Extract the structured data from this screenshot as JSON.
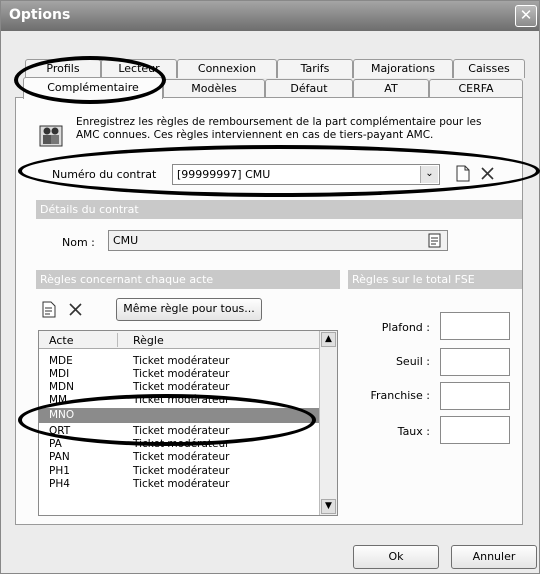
{
  "window": {
    "title": "Options",
    "close_glyph": "✕"
  },
  "tabs_back": [
    "Profils",
    "Lecteur",
    "Connexion",
    "Tarifs",
    "Majorations",
    "Caisses"
  ],
  "tabs_front": [
    "Complémentaire",
    "Modèles",
    "Défaut",
    "AT",
    "CERFA"
  ],
  "info": {
    "text_line1": "Enregistrez les règles de remboursement de la part complémentaire pour les",
    "text_line2": "AMC connues. Ces règles interviennent en cas de tiers-payant AMC."
  },
  "contract": {
    "label": "Numéro du contrat",
    "value": "[99999997] CMU"
  },
  "details": {
    "section": "Détails du contrat",
    "nom_label": "Nom :",
    "nom_value": "CMU"
  },
  "rules": {
    "section": "Règles concernant chaque acte",
    "same_rule_button": "Même règle pour tous...",
    "columns": [
      "Acte",
      "Règle"
    ],
    "rows": [
      {
        "acte": "MDE",
        "regle": "Ticket modérateur"
      },
      {
        "acte": "MDI",
        "regle": "Ticket modérateur"
      },
      {
        "acte": "MDN",
        "regle": "Ticket modérateur"
      },
      {
        "acte": "MM",
        "regle": "Ticket modérateur"
      },
      {
        "acte": "MNO",
        "regle": ""
      },
      {
        "acte": "ORT",
        "regle": "Ticket modérateur"
      },
      {
        "acte": "PA",
        "regle": "Ticket modérateur"
      },
      {
        "acte": "PAN",
        "regle": "Ticket modérateur"
      },
      {
        "acte": "PH1",
        "regle": "Ticket modérateur"
      },
      {
        "acte": "PH4",
        "regle": "Ticket modérateur"
      }
    ]
  },
  "totals": {
    "section": "Règles sur le total FSE",
    "plafond_label": "Plafond :",
    "seuil_label": "Seuil :",
    "franchise_label": "Franchise :",
    "taux_label": "Taux :"
  },
  "footer": {
    "ok": "Ok",
    "cancel": "Annuler"
  }
}
